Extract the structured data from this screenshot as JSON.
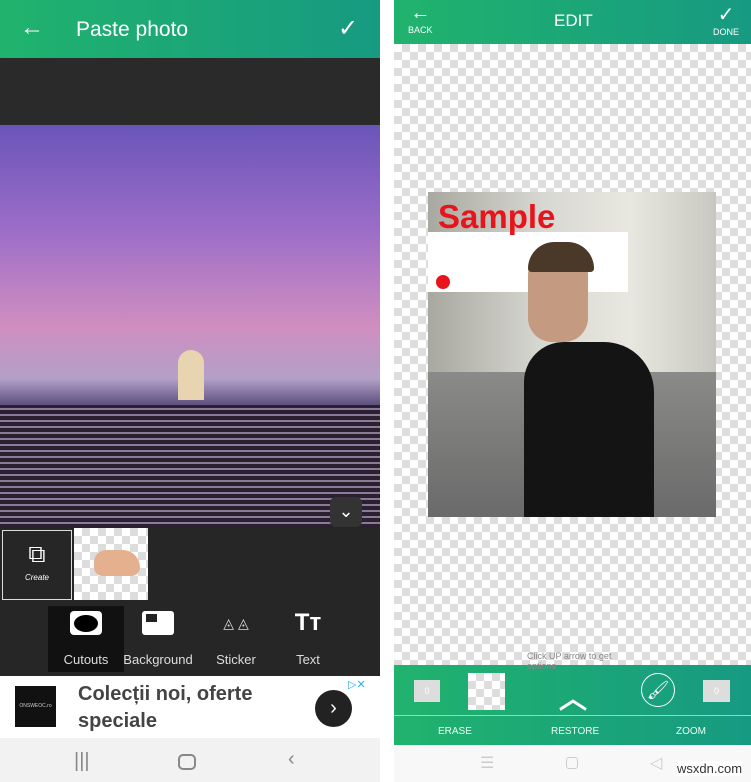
{
  "left": {
    "header": {
      "title": "Paste photo",
      "back_icon": "arrow-left-icon",
      "confirm_icon": "check-icon"
    },
    "thumbnails": {
      "create_label": "Create"
    },
    "tools": [
      {
        "label": "Cutouts",
        "icon": "cutout-icon"
      },
      {
        "label": "Background",
        "icon": "background-icon"
      },
      {
        "label": "Sticker",
        "icon": "cat-sticker-icon"
      },
      {
        "label": "Text",
        "icon": "text-icon"
      }
    ],
    "ad": {
      "logo_text": "ONSWEOC.ro",
      "headline": "Colecții noi, oferte speciale"
    }
  },
  "right": {
    "header": {
      "title": "EDIT",
      "back_label": "BACK",
      "done_label": "DONE"
    },
    "canvas": {
      "overlay_text": "Sample",
      "hint": "Click UP arrow to get options"
    },
    "bottom": {
      "left_value": "0",
      "right_value": "0",
      "tabs": [
        "ERASE",
        "RESTORE",
        "ZOOM"
      ]
    }
  },
  "watermark": "wsxdn.com",
  "colors": {
    "accent_green": "#20b36d",
    "sample_text": "#e8141b"
  }
}
